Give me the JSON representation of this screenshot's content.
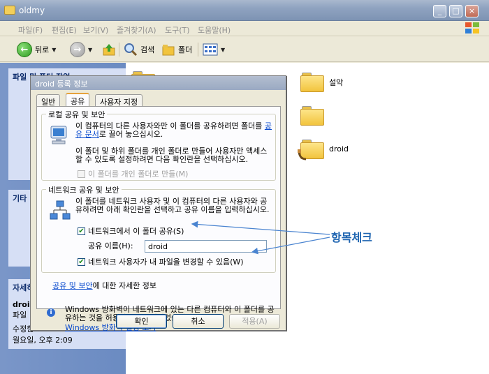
{
  "window": {
    "title": "oldmy"
  },
  "menu": [
    "파일(F)",
    "편집(E)",
    "보기(V)",
    "즐겨찾기(A)",
    "도구(T)",
    "도움말(H)"
  ],
  "toolbar": {
    "back": "뒤로",
    "search": "검색",
    "folders": "폴더"
  },
  "left_pane": {
    "task_title": "파일 및 폴더 작업",
    "other_title": "기타",
    "details_title": "자세히",
    "details_name": "droid",
    "details_type": "파일",
    "details_modified": "수정한",
    "details_date": "월요일, 오후 2:09"
  },
  "folders": [
    {
      "label": ""
    },
    {
      "label": "설악"
    },
    {
      "label": ""
    },
    {
      "label": "droid"
    }
  ],
  "dialog": {
    "title": "droid 등록 정보",
    "tabs": [
      "일반",
      "공유",
      "사용자 지정"
    ],
    "local_group": {
      "label": "로컬 공유 및 보안",
      "text1_pre": "이 컴퓨터의 다른 사용자와만 이 폴더를 공유하려면 폴더를 ",
      "text1_link": "공유 문서",
      "text1_post": "로 끌어 놓으십시오.",
      "text2": "이 폴더 및 하위 폴더를 개인 폴더로 만들어 사용자만 액세스할 수 있도록 설정하려면 다음 확인란을 선택하십시오.",
      "private_checkbox": "이 폴더를 개인 폴더로 만들(M)"
    },
    "network_group": {
      "label": "네트워크 공유 및 보안",
      "text": "이 폴더를 네트워크 사용자 및 이 컴퓨터의 다른 사용자와 공유하려면 아래 확인란을 선택하고 공유 이름을 입력하십시오.",
      "share_checkbox": "네트워크에서 이 폴더 공유(S)",
      "share_name_label": "공유 이름(H):",
      "share_name_value": "droid",
      "change_checkbox": "네트워크 사용자가 내 파일을 변경할 수 있음(W)",
      "more_link": "공유 및 보안",
      "more_suffix": "에 대한 자세한 정보"
    },
    "firewall": {
      "text": "Windows 방화벽이 네트워크에 있는 다른 컴퓨터와 이 폴더를 공유하는 것을 허용하도록 구성되었습니다.",
      "link": "Windows 방화벽 설정 보기"
    },
    "buttons": {
      "ok": "확인",
      "cancel": "취소",
      "apply": "적용(A)"
    }
  },
  "annotation": {
    "text": "항목체크",
    "color": "#1e64b0"
  }
}
